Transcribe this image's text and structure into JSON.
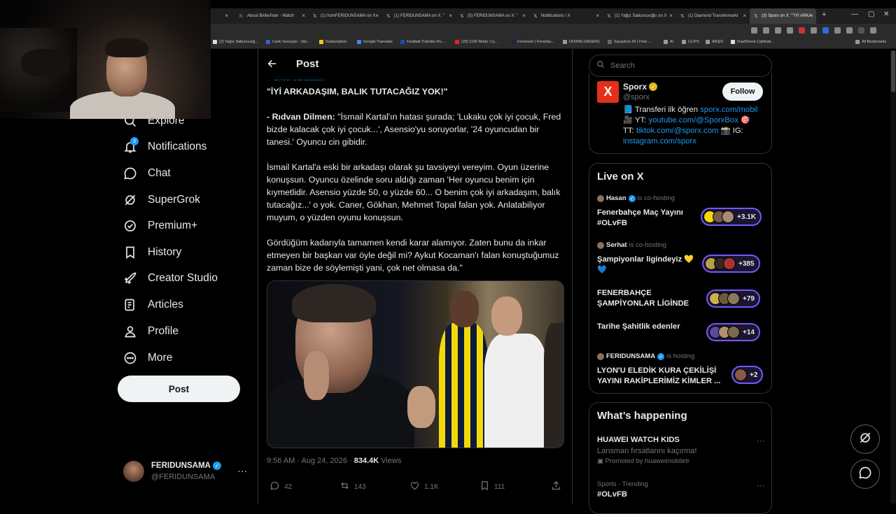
{
  "browser": {
    "tabs": [
      {
        "label": "About BirileriVarr - Watch"
      },
      {
        "label": "(1) fromFERIDUNSAMA on X"
      },
      {
        "label": "(1) FERIDUNSAMA on X: \""
      },
      {
        "label": "(5) FERIDUNSAMA on X: \""
      },
      {
        "label": "Notifications / X"
      },
      {
        "label": "(1) Yağız Sabuncuoğlu on X"
      },
      {
        "label": "(1) Diamond Transfermarkt"
      },
      {
        "label": "(3) Sporx on X: \"\"İYİ ARKA"
      }
    ],
    "bookmarks": [
      {
        "label": "(2) Yağız Sabuncuoğ..."
      },
      {
        "label": "Canlı Sonuçlar - İdd..."
      },
      {
        "label": "Subscription"
      },
      {
        "label": "Google Translate"
      },
      {
        "label": "Football Transfer Ru..."
      },
      {
        "label": "(29) 1100 Mods: Cy..."
      },
      {
        "label": "Fenerium | Fenerba..."
      },
      {
        "label": "DOWNLOADERS"
      },
      {
        "label": "Squadron 42 | First-..."
      },
      {
        "label": "AI"
      },
      {
        "label": "CLIPS"
      },
      {
        "label": "ARŞİV"
      },
      {
        "label": "DualShock Calibrati..."
      },
      {
        "label": "All Bookmarks"
      }
    ]
  },
  "nav": {
    "items": [
      {
        "label": "Explore",
        "icon": "search-icon"
      },
      {
        "label": "Notifications",
        "icon": "bell-icon"
      },
      {
        "label": "Chat",
        "icon": "chat-icon"
      },
      {
        "label": "SuperGrok",
        "icon": "grok-icon"
      },
      {
        "label": "Premium+",
        "icon": "premium-icon"
      },
      {
        "label": "History",
        "icon": "bookmark-icon"
      },
      {
        "label": "Creator Studio",
        "icon": "rocket-icon"
      },
      {
        "label": "Articles",
        "icon": "article-icon"
      },
      {
        "label": "Profile",
        "icon": "person-icon"
      },
      {
        "label": "More",
        "icon": "more-circle-icon"
      }
    ],
    "notifications_badge": "3",
    "post_button": "Post",
    "account": {
      "name": "FERIDUNSAMA",
      "handle": "@FERIDUNSAMA",
      "more": "···"
    }
  },
  "post": {
    "header_title": "Post",
    "show_translation": "Show translation",
    "headline": "\"İYİ ARKADAŞIM, BALIK TUTACAĞIZ YOK!\"",
    "speaker": "- Rıdvan Dilmen:",
    "para1": " \"İsmail Kartal'ın hatası şurada; 'Lukaku çok iyi çocuk, Fred bizde kalacak çok iyi çocuk...', Asensio'yu soruyorlar, '24 oyuncudan bir tanesi.' Oyuncu cin gibidir.",
    "para2": "İsmail Kartal'a eski bir arkadaşı olarak şu tavsiyeyi vereyim. Oyun üzerine konuşsun. Oyuncu özelinde soru aldığı zaman 'Her oyuncu benim için kıymetlidir. Asensio yüzde 50, o yüzde 60... O benim çok iyi arkadaşım, balık tutacağız...' o yok. Caner, Gökhan, Mehmet Topal falan yok. Anlatabiliyor muyum, o yüzden oyunu konuşsun.",
    "para3": "Gördüğüm kadarıyla tamamen kendi karar alamıyor. Zaten bunu da inkar etmeyen bir başkan var öyle değil mi? Aykut Kocaman'ı falan konuştuğumuz zaman bize de söylemişti yani, çok net olmasa da.\"",
    "time": "9:56 AM · Aug 24, 2026 · ",
    "views_count": "834.4K",
    "views_label": " Views",
    "actions": {
      "replies": "42",
      "reposts": "143",
      "likes": "1.1K",
      "bookmarks": "111"
    }
  },
  "right": {
    "search_placeholder": "Search",
    "profile": {
      "name": "Sporx",
      "handle": "@sporx",
      "follow": "Follow",
      "bio_l1_pre": "📘 Transferi ilk öğren ",
      "bio_l1_link": "sporx.com/mobil",
      "bio_l2_pre": "🎥 YT: ",
      "bio_l2_link": "youtube.com/@SporxBox",
      "bio_l2_post": " 🎯",
      "bio_l3_pre": "TT: ",
      "bio_l3_link": "tiktok.com/@sporx.com",
      "bio_l3_post": " 📸 IG:",
      "bio_l4_link": "instagram.com/sporx"
    },
    "live": {
      "title": "Live on X",
      "items": [
        {
          "host": "Hasan",
          "role": "is co-hosting",
          "title": "Fenerbahçe Maç Yayını #OLvFB",
          "count": "+3.1K"
        },
        {
          "host": "Serhat",
          "role": "is co-hosting",
          "title": "Şampiyonlar ligindeyiz 💛💙",
          "count": "+385"
        },
        {
          "host": "",
          "role": "",
          "title": "FENERBAHÇE ŞAMPİYONLAR LİGİNDE",
          "count": "+79"
        },
        {
          "host": "",
          "role": "",
          "title": "Tarihe Şahitlik edenler",
          "count": "+14"
        },
        {
          "host": "FERIDUNSAMA",
          "role": "is hosting",
          "title": "LYON'U ELEDİK KURA ÇEKİLİŞİ YAYINI RAKİPLERİMİZ KİMLER ...",
          "count": "+2"
        }
      ]
    },
    "happening": {
      "title": "What’s happening",
      "trends": [
        {
          "title": "HUAWEI WATCH KIDS",
          "sub": "Lansman fırsatlarını kaçırma!",
          "promo": "Promoted by huaweimobiletr"
        },
        {
          "context": "Sports · Trending",
          "title": "#OLvFB"
        }
      ]
    }
  },
  "colors": {
    "accent": "#1d9bf0",
    "background": "#000000",
    "live_border": "#7856ff",
    "sporx_red": "#e3301a"
  }
}
